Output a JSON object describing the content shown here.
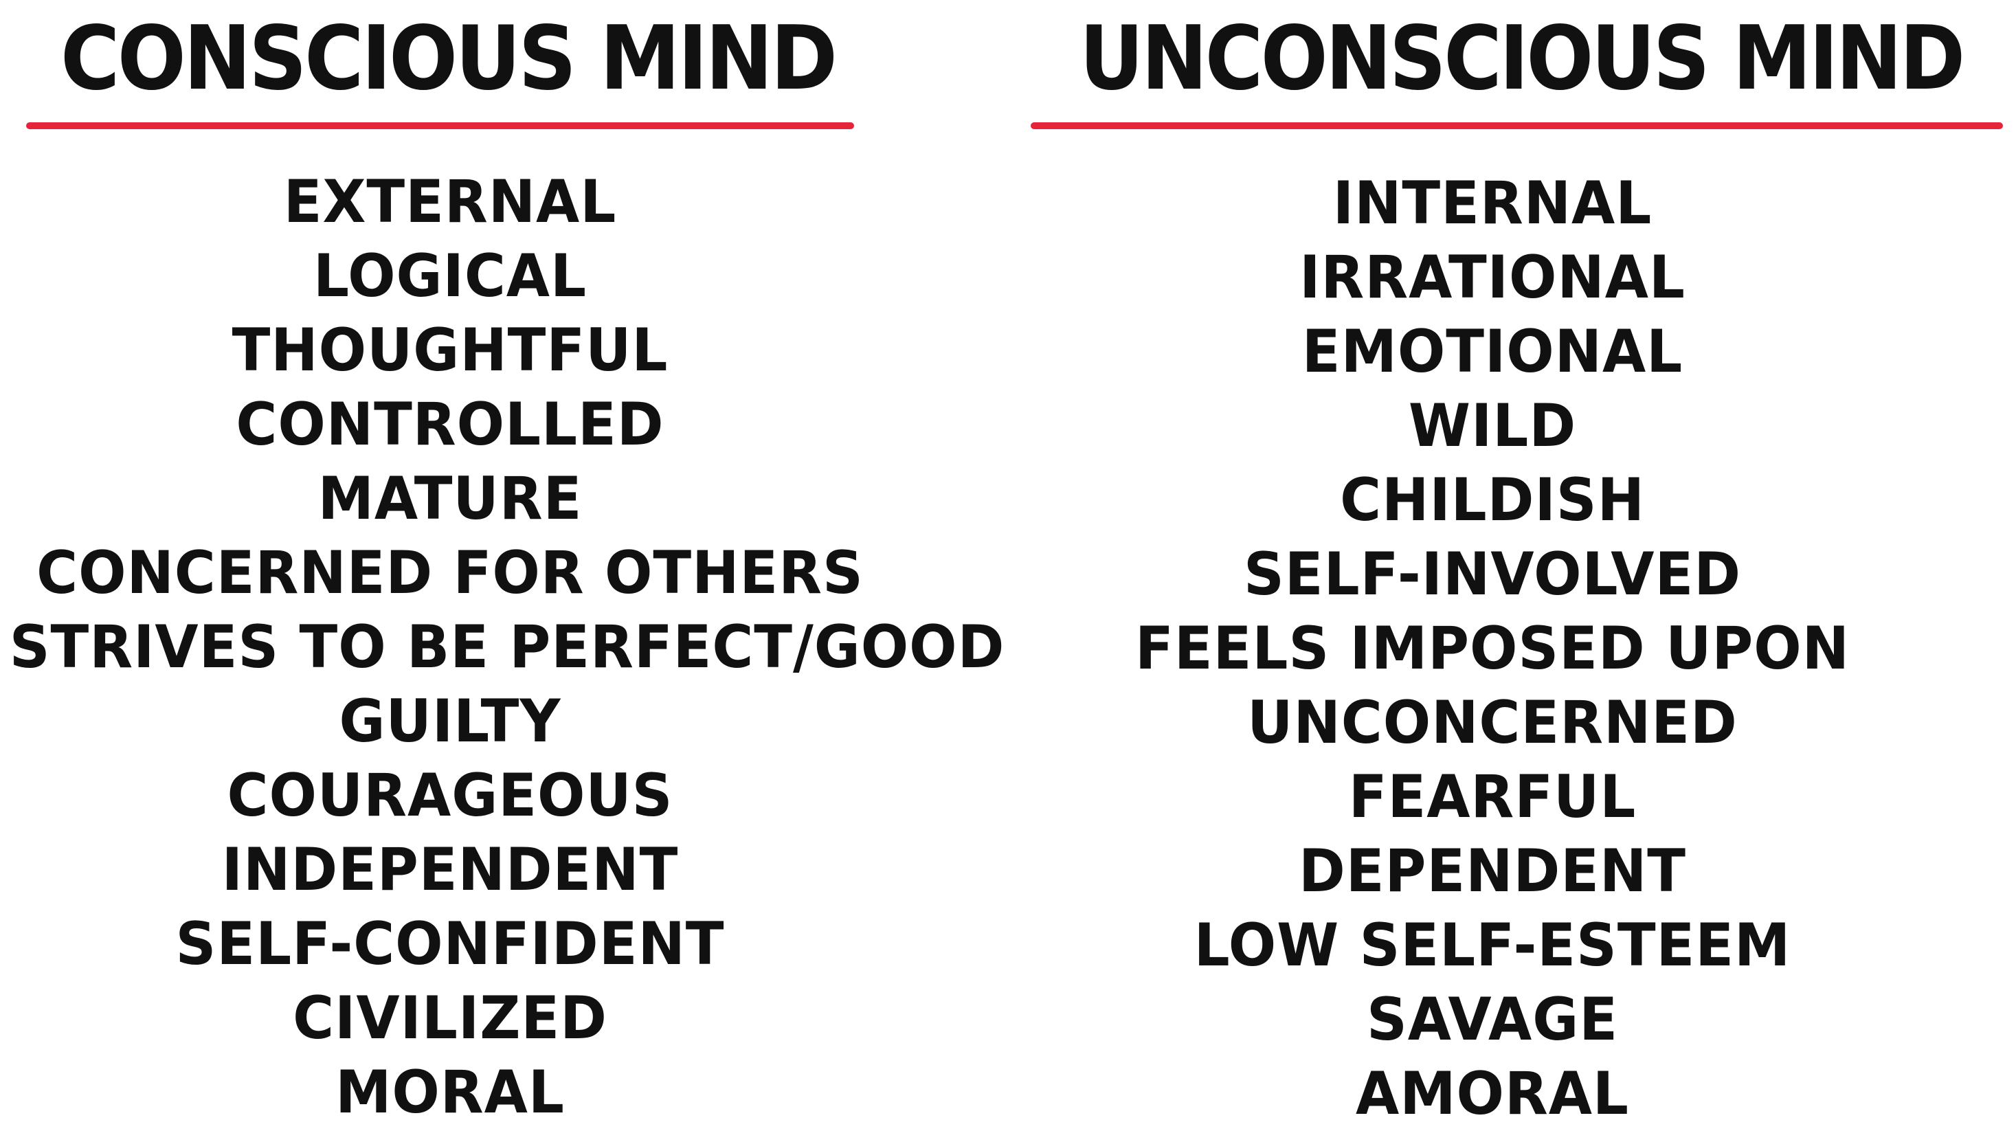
{
  "left": {
    "title": "CONSCIOUS MIND",
    "items": [
      "EXTERNAL",
      "LOGICAL",
      "THOUGHTFUL",
      "CONTROLLED",
      "MATURE",
      "CONCERNED FOR OTHERS",
      "STRIVES TO BE PERFECT/GOOD",
      "GUILTY",
      "COURAGEOUS",
      "INDEPENDENT",
      "SELF-CONFIDENT",
      "CIVILIZED",
      "MORAL"
    ]
  },
  "right": {
    "title": "UNCONSCIOUS MIND",
    "items": [
      "INTERNAL",
      "IRRATIONAL",
      "EMOTIONAL",
      "WILD",
      "CHILDISH",
      "SELF-INVOLVED",
      "FEELS IMPOSED UPON",
      "UNCONCERNED",
      "FEARFUL",
      "DEPENDENT",
      "LOW SELF-ESTEEM",
      "SAVAGE",
      "AMORAL"
    ]
  },
  "colors": {
    "text": "#111111",
    "underline": "#e3243b",
    "background": "#ffffff"
  }
}
